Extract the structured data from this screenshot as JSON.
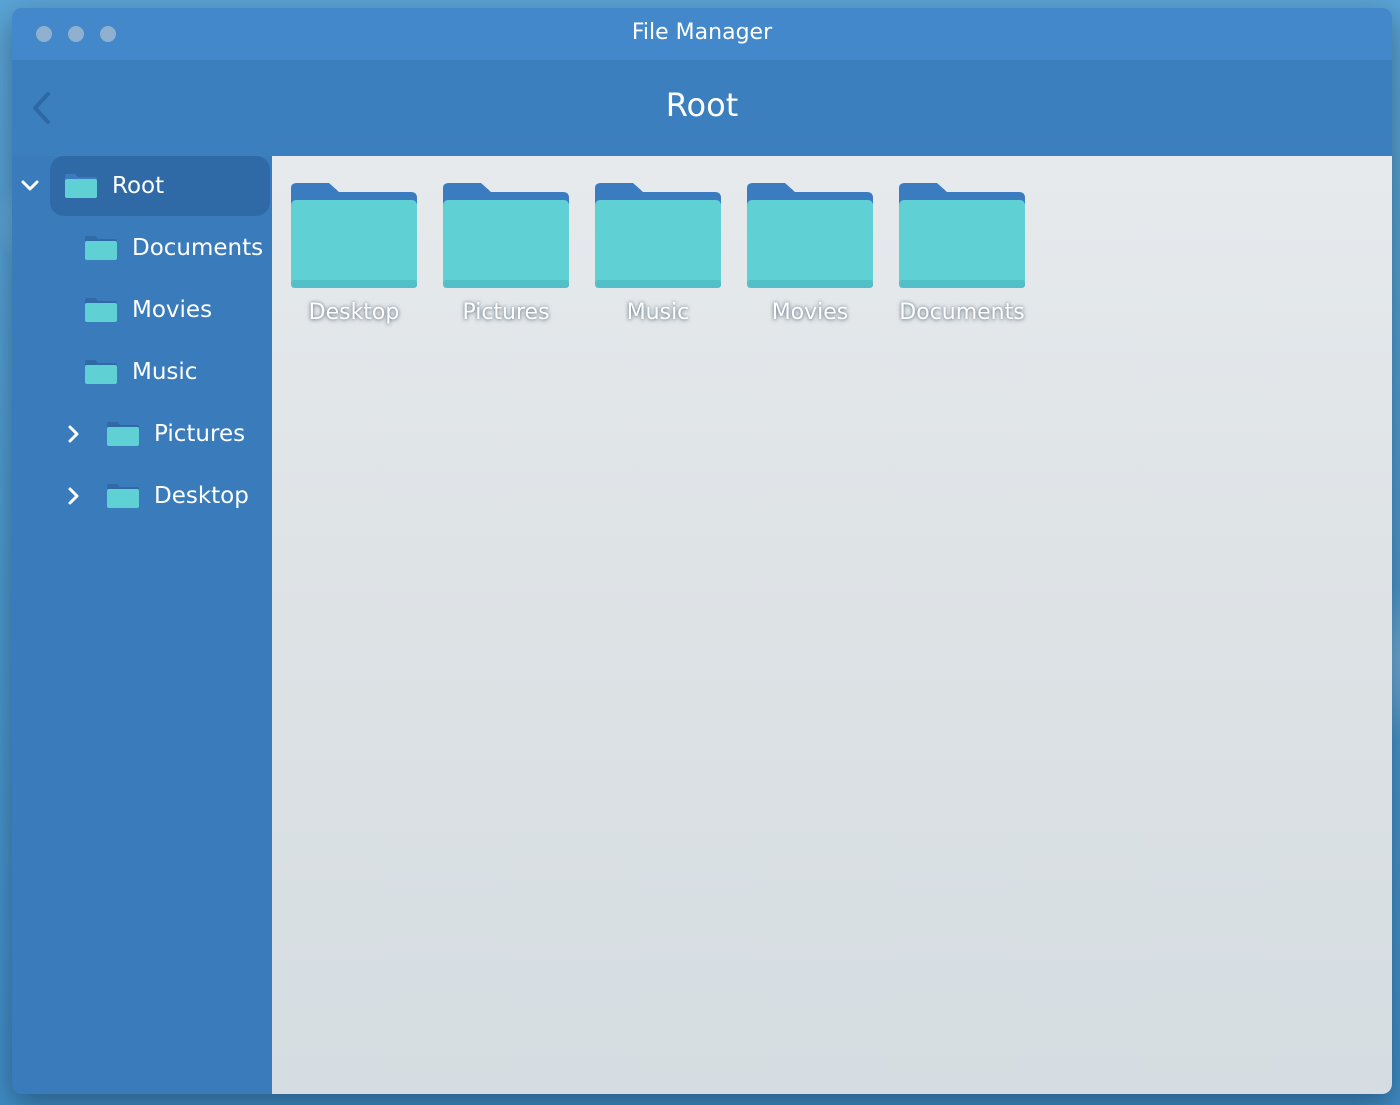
{
  "window": {
    "title": "File Manager"
  },
  "header": {
    "title": "Root"
  },
  "sidebar": {
    "items": [
      {
        "label": "Root",
        "chevron": "chevron-down-icon",
        "selected": true
      },
      {
        "label": "Documents",
        "chevron": null,
        "selected": false
      },
      {
        "label": "Movies",
        "chevron": null,
        "selected": false
      },
      {
        "label": "Music",
        "chevron": null,
        "selected": false
      },
      {
        "label": "Pictures",
        "chevron": "chevron-right-icon",
        "selected": false
      },
      {
        "label": "Desktop",
        "chevron": "chevron-right-icon",
        "selected": false
      }
    ]
  },
  "content": {
    "folders": [
      {
        "label": "Desktop"
      },
      {
        "label": "Pictures"
      },
      {
        "label": "Music"
      },
      {
        "label": "Movies"
      },
      {
        "label": "Documents"
      }
    ]
  },
  "colors": {
    "folder_front": "#5fd1d4",
    "folder_back": "#3b7bc0",
    "accent": "#4488cc"
  }
}
